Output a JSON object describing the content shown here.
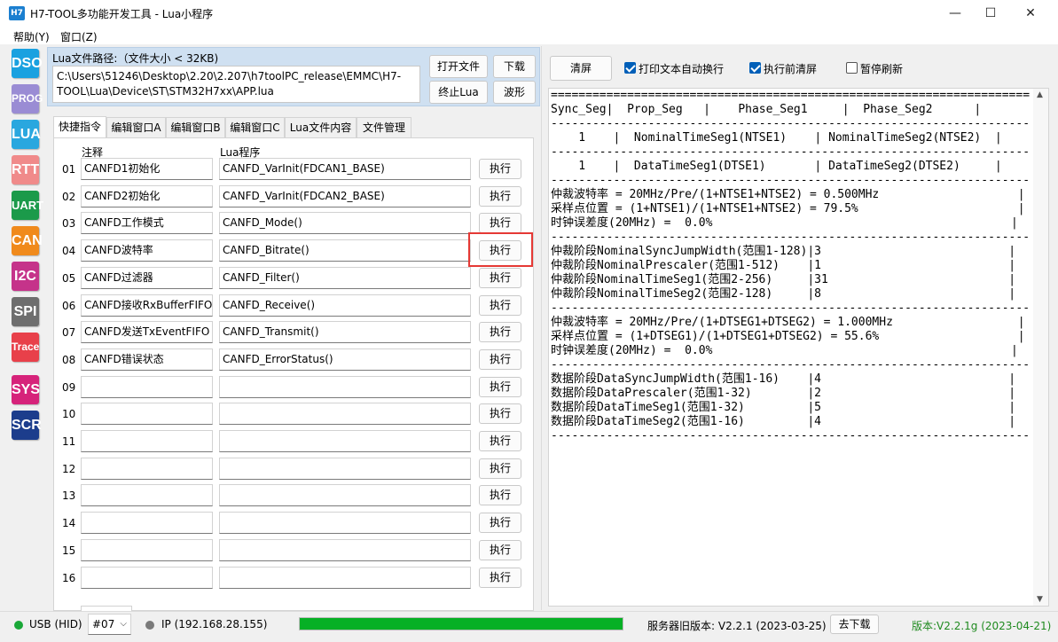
{
  "window": {
    "icon_text": "H7",
    "title": "H7-TOOL多功能开发工具 - Lua小程序",
    "minimize": "—",
    "maximize": "☐",
    "close": "✕"
  },
  "menu": [
    "帮助(Y)",
    "窗口(Z)"
  ],
  "sidebar": [
    {
      "label": "DSO",
      "color": "#1aa1e0"
    },
    {
      "label": "PROG",
      "color": "#9a8cd4"
    },
    {
      "label": "LUA",
      "color": "#29a7df"
    },
    {
      "label": "RTT",
      "color": "#f08a8a"
    },
    {
      "label": "UART",
      "color": "#1b9a4a"
    },
    {
      "label": "CAN",
      "color": "#f08a1c"
    },
    {
      "label": "I2C",
      "color": "#c5338a"
    },
    {
      "label": "SPI",
      "color": "#6e6e6e"
    },
    {
      "label": "Trace",
      "color": "#e8404a"
    },
    {
      "label": "SYS",
      "color": "#d6237a"
    },
    {
      "label": "SCR",
      "color": "#1c3d8c"
    }
  ],
  "lua_file": {
    "label": "Lua文件路径:（文件大小 < 32KB)",
    "path": "C:\\Users\\51246\\Desktop\\2.20\\2.207\\h7toolPC_release\\EMMC\\H7-TOOL\\Lua\\Device\\ST\\STM32H7xx\\APP.lua",
    "open_button": "打开文件",
    "download_button": "下载",
    "stop_button": "终止Lua",
    "wave_button": "波形"
  },
  "tabs": [
    "快捷指令",
    "编辑窗口A",
    "编辑窗口B",
    "编辑窗口C",
    "Lua文件内容",
    "文件管理"
  ],
  "table": {
    "col_note": "注释",
    "col_program": "Lua程序",
    "exec_label": "执行",
    "rows": [
      {
        "num": "01",
        "note": "CANFD1初始化",
        "program": "CANFD_VarInit(FDCAN1_BASE)"
      },
      {
        "num": "02",
        "note": "CANFD2初始化",
        "program": "CANFD_VarInit(FDCAN2_BASE)"
      },
      {
        "num": "03",
        "note": "CANFD工作模式",
        "program": "CANFD_Mode()"
      },
      {
        "num": "04",
        "note": "CANFD波特率",
        "program": "CANFD_Bitrate()"
      },
      {
        "num": "05",
        "note": "CANFD过滤器",
        "program": "CANFD_Filter()"
      },
      {
        "num": "06",
        "note": "CANFD接收RxBufferFIFO",
        "program": "CANFD_Receive()"
      },
      {
        "num": "07",
        "note": "CANFD发送TxEventFIFO",
        "program": "CANFD_Transmit()"
      },
      {
        "num": "08",
        "note": "CANFD错误状态",
        "program": "CANFD_ErrorStatus()"
      },
      {
        "num": "09",
        "note": "",
        "program": ""
      },
      {
        "num": "10",
        "note": "",
        "program": ""
      },
      {
        "num": "11",
        "note": "",
        "program": ""
      },
      {
        "num": "12",
        "note": "",
        "program": ""
      },
      {
        "num": "13",
        "note": "",
        "program": ""
      },
      {
        "num": "14",
        "note": "",
        "program": ""
      },
      {
        "num": "15",
        "note": "",
        "program": ""
      },
      {
        "num": "16",
        "note": "",
        "program": ""
      }
    ]
  },
  "console_toolbar": {
    "clear_button": "清屏",
    "wrap_label": "打印文本自动换行",
    "wrap_checked": true,
    "clear_before_label": "执行前清屏",
    "clear_before_checked": true,
    "pause_label": "暂停刷新",
    "pause_checked": false
  },
  "console_text": "=====================================================================\nSync_Seg|  Prop_Seg   |    Phase_Seg1     |  Phase_Seg2      |\n---------------------------------------------------------------------\n    1    |  NominalTimeSeg1(NTSE1)    | NominalTimeSeg2(NTSE2)  |\n---------------------------------------------------------------------\n    1    |  DataTimeSeg1(DTSE1)       | DataTimeSeg2(DTSE2)     |\n---------------------------------------------------------------------\n仲裁波特率 = 20MHz/Pre/(1+NTSE1+NTSE2) = 0.500MHz                    |\n采样点位置 = (1+NTSE1)/(1+NTSE1+NTSE2) = 79.5%                       |\n时钟误差度(20MHz) =  0.0%                                           |\n---------------------------------------------------------------------\n仲裁阶段NominalSyncJumpWidth(范围1-128)|3                           |\n仲裁阶段NominalPrescaler(范围1-512)    |1                           |\n仲裁阶段NominalTimeSeg1(范围2-256)     |31                          |\n仲裁阶段NominalTimeSeg2(范围2-128)     |8                           |\n---------------------------------------------------------------------\n仲裁波特率 = 20MHz/Pre/(1+DTSEG1+DTSEG2) = 1.000MHz                  |\n采样点位置 = (1+DTSEG1)/(1+DTSEG1+DTSEG2) = 55.6%                    |\n时钟误差度(20MHz) =  0.0%                                           |\n---------------------------------------------------------------------\n数据阶段DataSyncJumpWidth(范围1-16)    |4                           |\n数据阶段DataPrescaler(范围1-32)        |2                           |\n数据阶段DataTimeSeg1(范围1-32)         |5                           |\n数据阶段DataTimeSeg2(范围1-16)         |4                           |\n---------------------------------------------------------------------",
  "status": {
    "usb_label": "USB (HID)",
    "usb_color": "#1aa838",
    "device_select": "#07",
    "ip_label": "IP (192.168.28.155)",
    "ip_color": "#7a7a7a",
    "progress": 1.0,
    "server_version": "服务器旧版本: V2.2.1 (2023-03-25)",
    "download_button": "去下载",
    "version": "版本:V2.2.1g (2023-04-21)",
    "version_color": "#1f8a1f"
  }
}
